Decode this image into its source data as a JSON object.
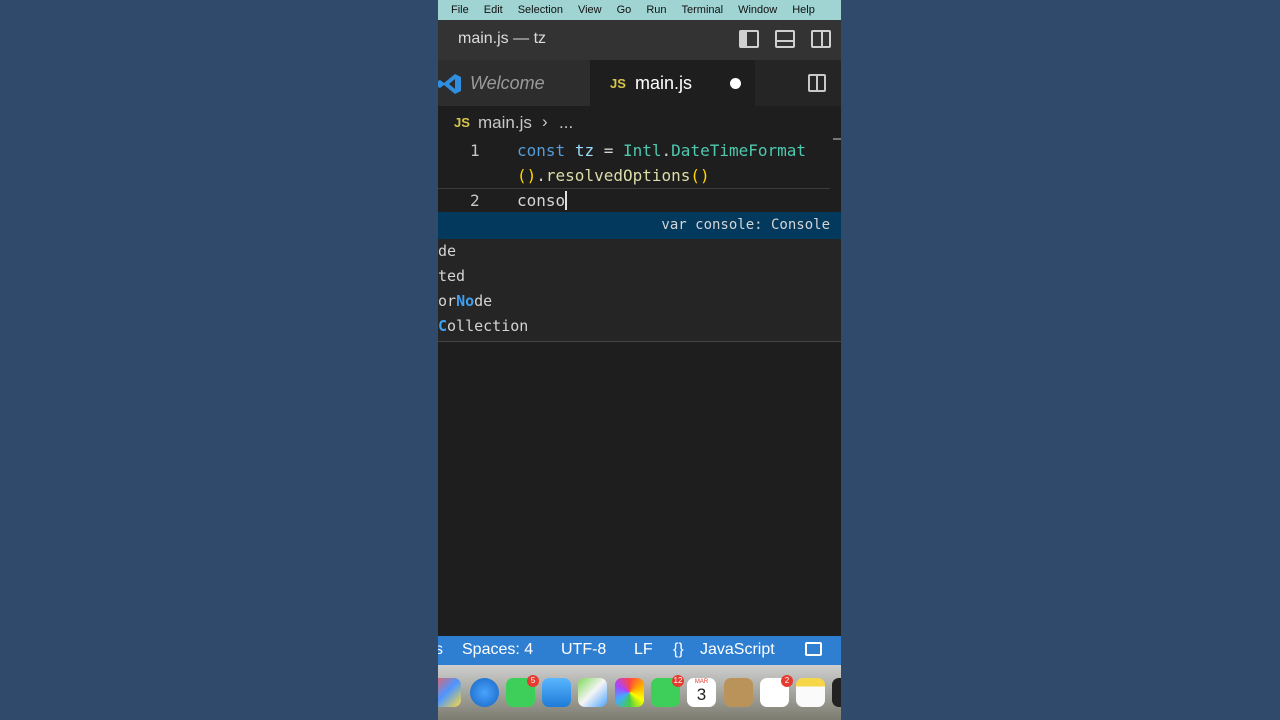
{
  "menubar": {
    "items": [
      "File",
      "Edit",
      "Selection",
      "View",
      "Go",
      "Run",
      "Terminal",
      "Window",
      "Help"
    ]
  },
  "window": {
    "title": "main.js — tz"
  },
  "tabs": [
    {
      "label": "Welcome",
      "icon": "vscode-logo-icon"
    },
    {
      "label": "main.js",
      "badge": "JS",
      "dirty": true
    }
  ],
  "breadcrumb": {
    "badge": "JS",
    "file": "main.js",
    "separator": "›",
    "rest": "..."
  },
  "editor": {
    "lines": [
      {
        "number": "1"
      },
      {
        "number": "2"
      }
    ],
    "line1": {
      "kw": "const",
      "var": "tz",
      "eq": "=",
      "cls": "Intl",
      "dot": ".",
      "fn": "DateTimeFormat"
    },
    "line1b": {
      "paren": "()",
      "dot": ".",
      "fn": "resolvedOptions",
      "paren2": "()"
    },
    "line2": {
      "text": "conso"
    }
  },
  "suggest": {
    "detail": "var console: Console",
    "items": [
      {
        "pre": "",
        "match": "",
        "post": "de"
      },
      {
        "pre": "",
        "match": "",
        "post": "ted"
      },
      {
        "pre": "or",
        "match": "No",
        "post": "de"
      },
      {
        "pre": "",
        "match": "C",
        "post": "ollection"
      }
    ]
  },
  "statusbar": {
    "edge": "s",
    "spaces": "Spaces: 4",
    "encoding": "UTF-8",
    "eol": "LF",
    "lang_icon": "{}",
    "language": "JavaScript"
  },
  "dock": {
    "calendar_month": "MAR",
    "calendar_day": "3",
    "badges": {
      "messages": "5",
      "facetime": "12",
      "reminders": "2"
    }
  },
  "colors": {
    "menubar_bg": "#9fd4d2",
    "statusbar_bg": "#2e7fd2",
    "editor_bg": "#1e1e1e",
    "suggest_selected": "#04395e"
  }
}
